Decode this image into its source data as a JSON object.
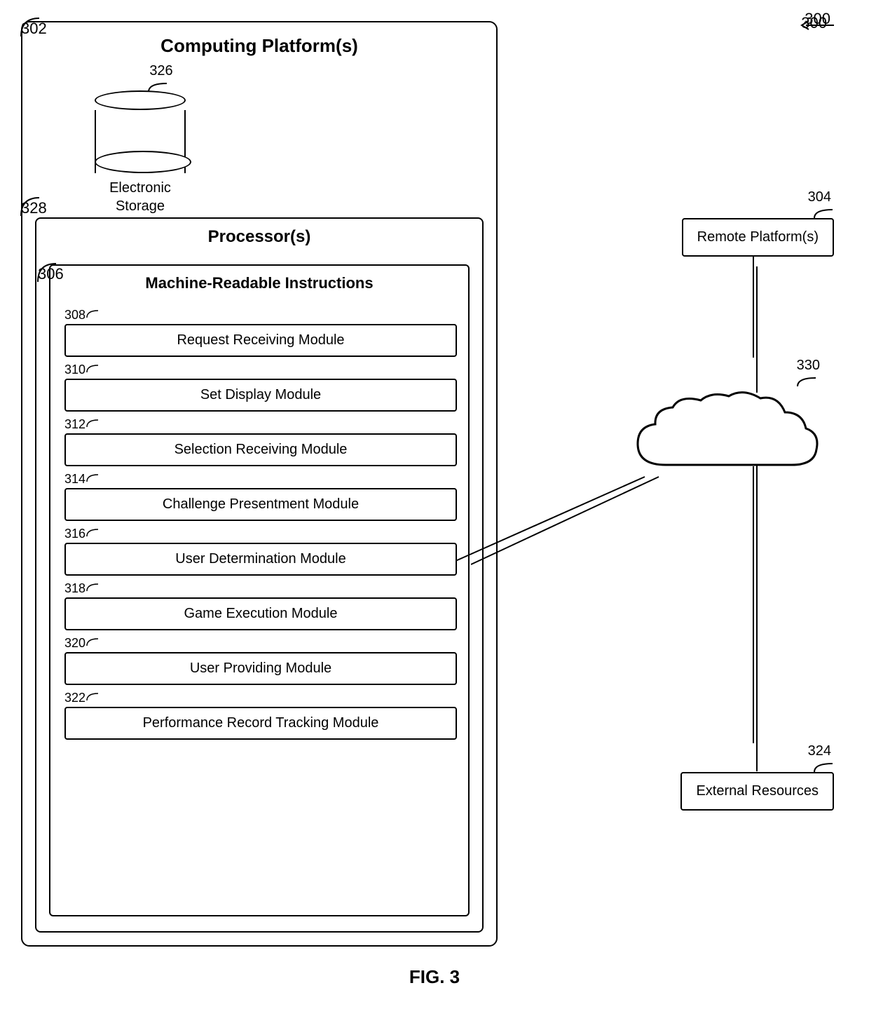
{
  "diagram": {
    "figure_label": "FIG. 3",
    "ref_300": "300",
    "ref_302": "302",
    "ref_304": "304",
    "ref_306": "306",
    "ref_308": "308",
    "ref_310": "310",
    "ref_312": "312",
    "ref_314": "314",
    "ref_316": "316",
    "ref_318": "318",
    "ref_320": "320",
    "ref_322": "322",
    "ref_324": "324",
    "ref_326": "326",
    "ref_328": "328",
    "ref_330": "330",
    "computing_platform_title": "Computing Platform(s)",
    "storage_label_line1": "Electronic",
    "storage_label_line2": "Storage",
    "processor_title": "Processor(s)",
    "mri_title": "Machine-Readable Instructions",
    "remote_platform_label": "Remote Platform(s)",
    "external_resources_label": "External Resources",
    "modules": [
      {
        "ref": "308",
        "label": "Request Receiving Module"
      },
      {
        "ref": "310",
        "label": "Set Display Module"
      },
      {
        "ref": "312",
        "label": "Selection Receiving Module"
      },
      {
        "ref": "314",
        "label": "Challenge Presentment Module"
      },
      {
        "ref": "316",
        "label": "User Determination Module"
      },
      {
        "ref": "318",
        "label": "Game Execution Module"
      },
      {
        "ref": "320",
        "label": "User Providing Module"
      },
      {
        "ref": "322",
        "label": "Performance Record Tracking Module"
      }
    ]
  }
}
